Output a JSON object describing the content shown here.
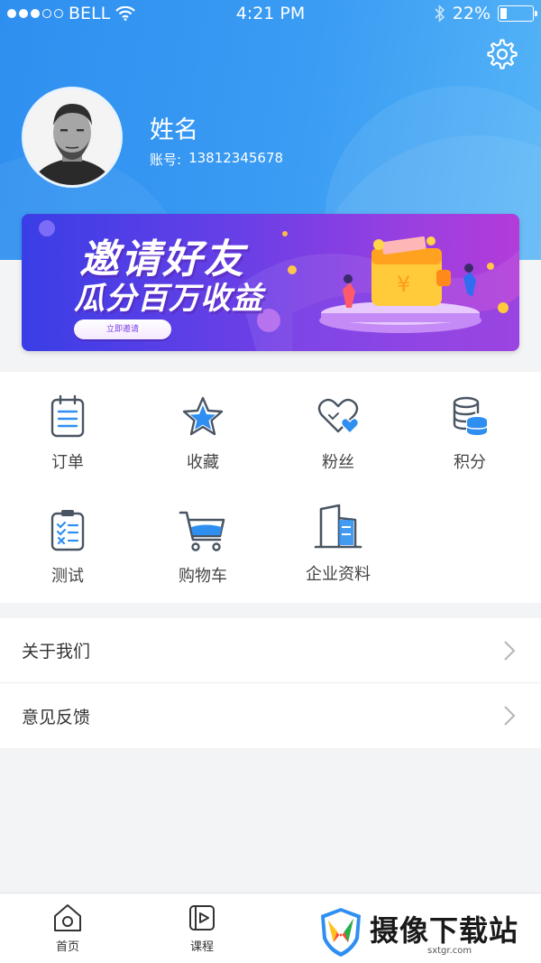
{
  "status_bar": {
    "carrier": "BELL",
    "time": "4:21 PM",
    "battery_percent": "22%",
    "battery_level": 0.22,
    "signal_filled": 3,
    "signal_total": 5
  },
  "header": {
    "settings_icon": "gear-icon",
    "user_name": "姓名",
    "account_label": "账号:",
    "account_number": "13812345678"
  },
  "banner": {
    "title": "邀请好友",
    "subtitle": "瓜分百万收益",
    "button_label": "立即邀请",
    "wallet_symbol": "¥"
  },
  "menu_grid": [
    {
      "label": "订单",
      "icon": "order-icon"
    },
    {
      "label": "收藏",
      "icon": "star-icon"
    },
    {
      "label": "粉丝",
      "icon": "heart-icon"
    },
    {
      "label": "积分",
      "icon": "coins-icon"
    },
    {
      "label": "测试",
      "icon": "checklist-icon"
    },
    {
      "label": "购物车",
      "icon": "cart-icon"
    },
    {
      "label": "企业资料",
      "icon": "building-icon"
    }
  ],
  "list": [
    {
      "label": "关于我们"
    },
    {
      "label": "意见反馈"
    }
  ],
  "tabbar": [
    {
      "label": "首页",
      "icon": "home-icon"
    },
    {
      "label": "课程",
      "icon": "video-icon"
    }
  ],
  "watermark": {
    "name": "摄像下载站",
    "url": "sxtgr.com"
  },
  "colors": {
    "header_blue": "#3a9cf3",
    "icon_dark": "#4a5563",
    "icon_blue": "#2f8ff0",
    "banner_purple": "#7a3fe0"
  }
}
